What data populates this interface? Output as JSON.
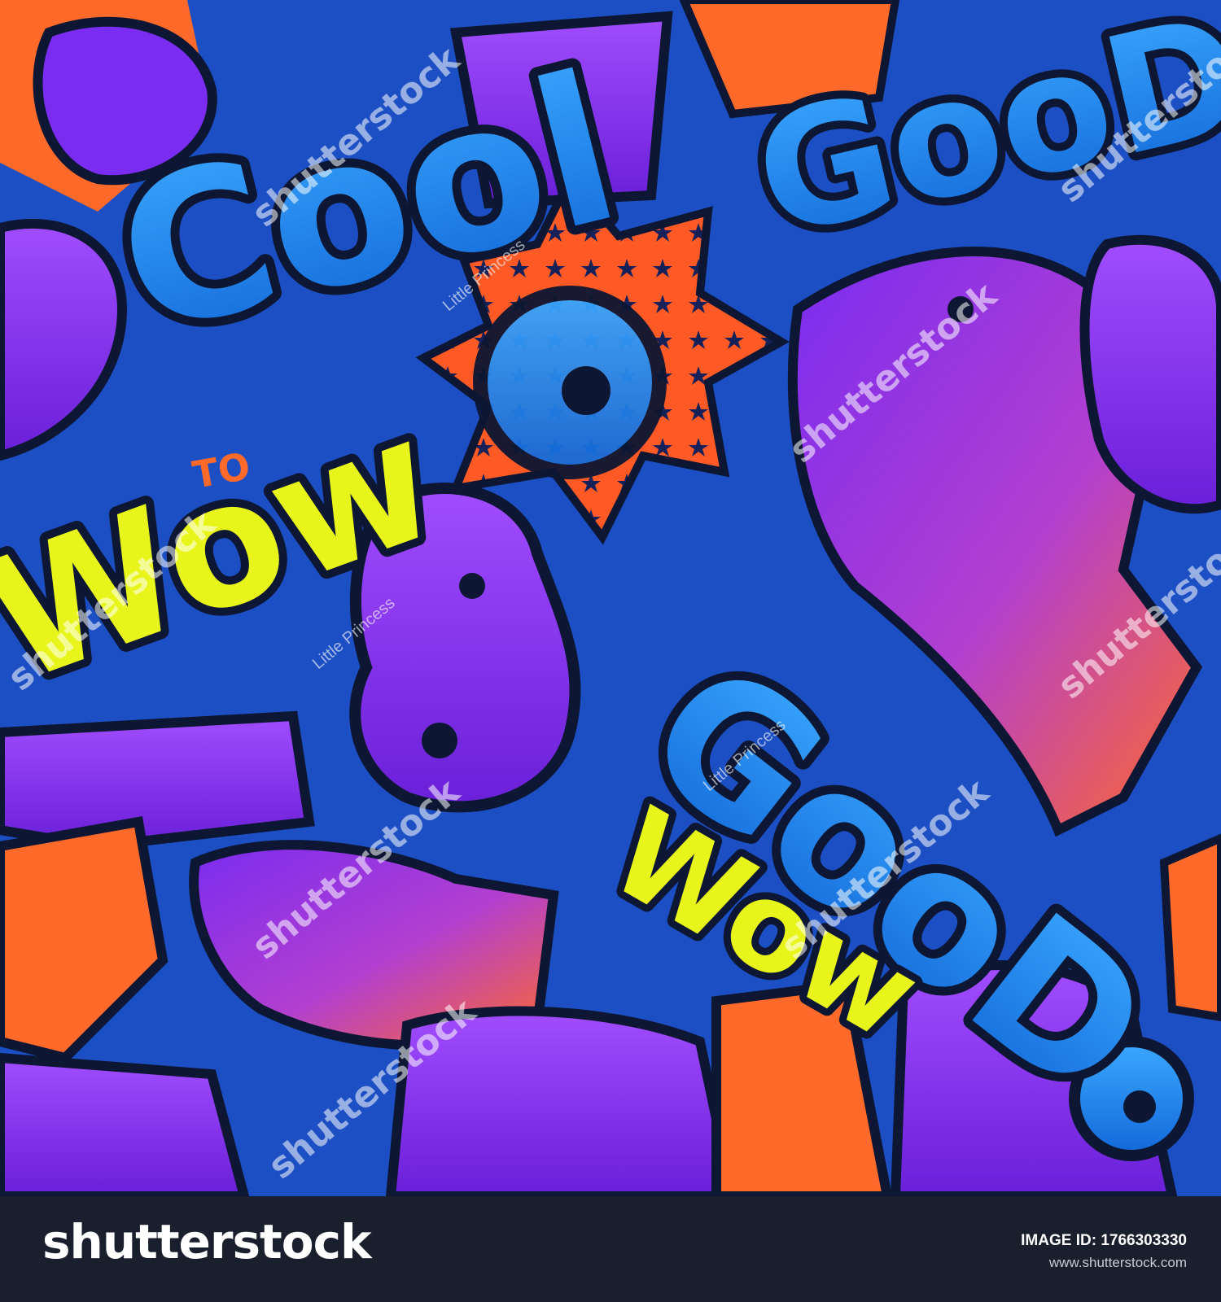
{
  "artwork": {
    "words": [
      {
        "id": "cool",
        "text": "Cool"
      },
      {
        "id": "good-top-right",
        "text": "GooD"
      },
      {
        "id": "good-center",
        "text": "GooD"
      },
      {
        "id": "wow-left",
        "text": "Wow"
      },
      {
        "id": "wow-bottom",
        "text": "Wow"
      },
      {
        "id": "to",
        "text": "TO"
      }
    ],
    "colors": {
      "background": "#1c4fc4",
      "bubble_blue": "#1e90f0",
      "purple": "#8a2be2",
      "orange": "#ff6a2a",
      "yellow": "#e8f51a",
      "outline": "#0d1733"
    }
  },
  "watermarks": {
    "brand": "shutterstock",
    "author": "Little Princess"
  },
  "footer": {
    "logo": "shutterstock",
    "image_id": "IMAGE ID: 1766303330",
    "url": "www.shutterstock.com"
  }
}
